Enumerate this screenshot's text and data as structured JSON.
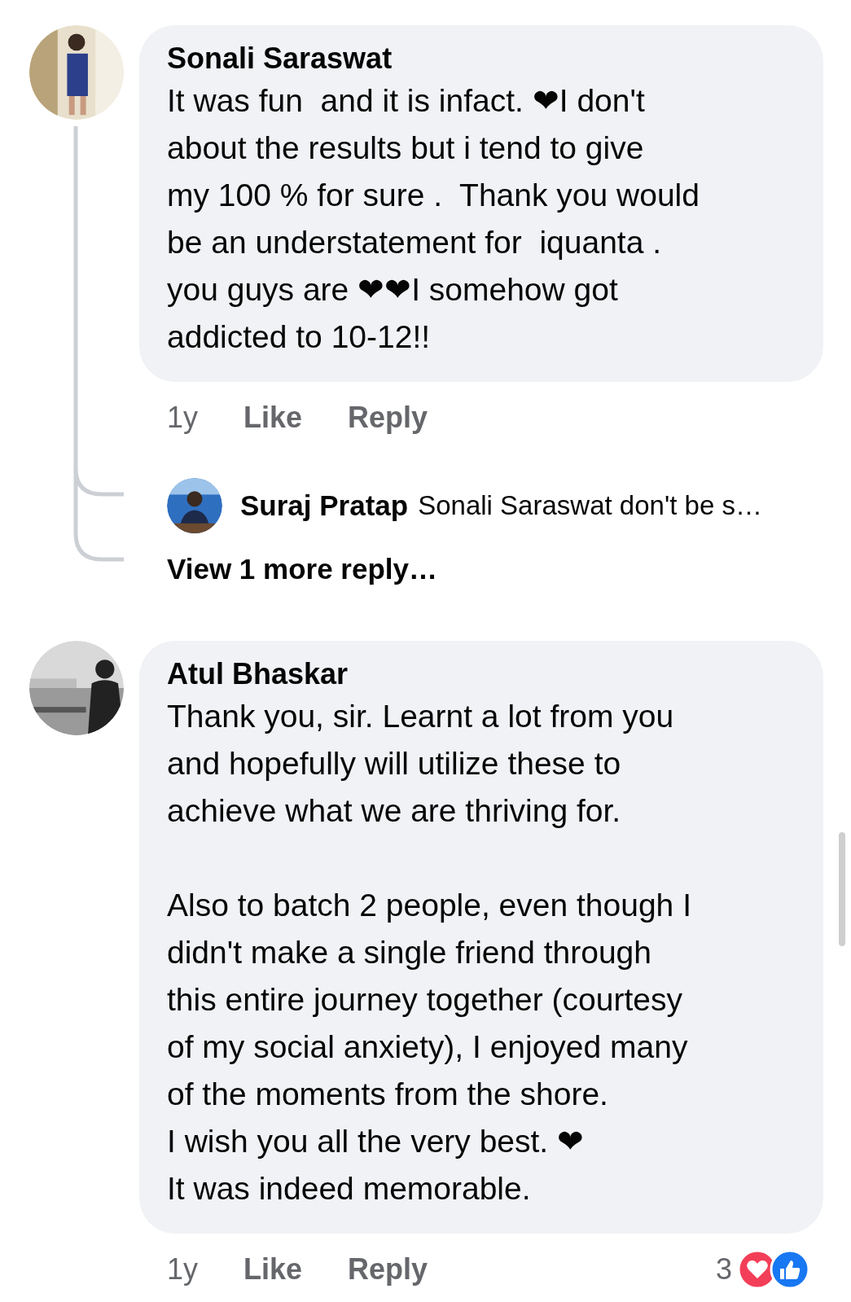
{
  "comments": [
    {
      "author": "Sonali Saraswat",
      "avatar": {
        "kind": "picture"
      },
      "body": "It was fun  and it is infact. ❤I don't\nabout the results but i tend to give\nmy 100 % for sure .  Thank you would\nbe an understatement for  iquanta .\nyou guys are ❤❤I somehow got\naddicted to 10-12!!",
      "time": "1y",
      "actions": [
        "Like",
        "Reply"
      ],
      "replies": [
        {
          "author": "Suraj Pratap",
          "text": "Sonali Saraswat don't be s…",
          "avatar": {
            "kind": "picture"
          }
        }
      ],
      "more_replies": "View 1 more reply…"
    },
    {
      "author": "Atul Bhaskar",
      "avatar": {
        "kind": "picture"
      },
      "body": "Thank you, sir. Learnt a lot from you\nand hopefully will utilize these to\nachieve what we are thriving for.\n\nAlso to batch 2 people, even though I\ndidn't make a single friend through\nthis entire journey together (courtesy\nof my social anxiety), I enjoyed many\nof the moments from the shore.\nI wish you all the very best. ❤\nIt was indeed memorable.",
      "time": "1y",
      "actions": [
        "Like",
        "Reply"
      ],
      "reactions": {
        "count": "3"
      }
    }
  ]
}
